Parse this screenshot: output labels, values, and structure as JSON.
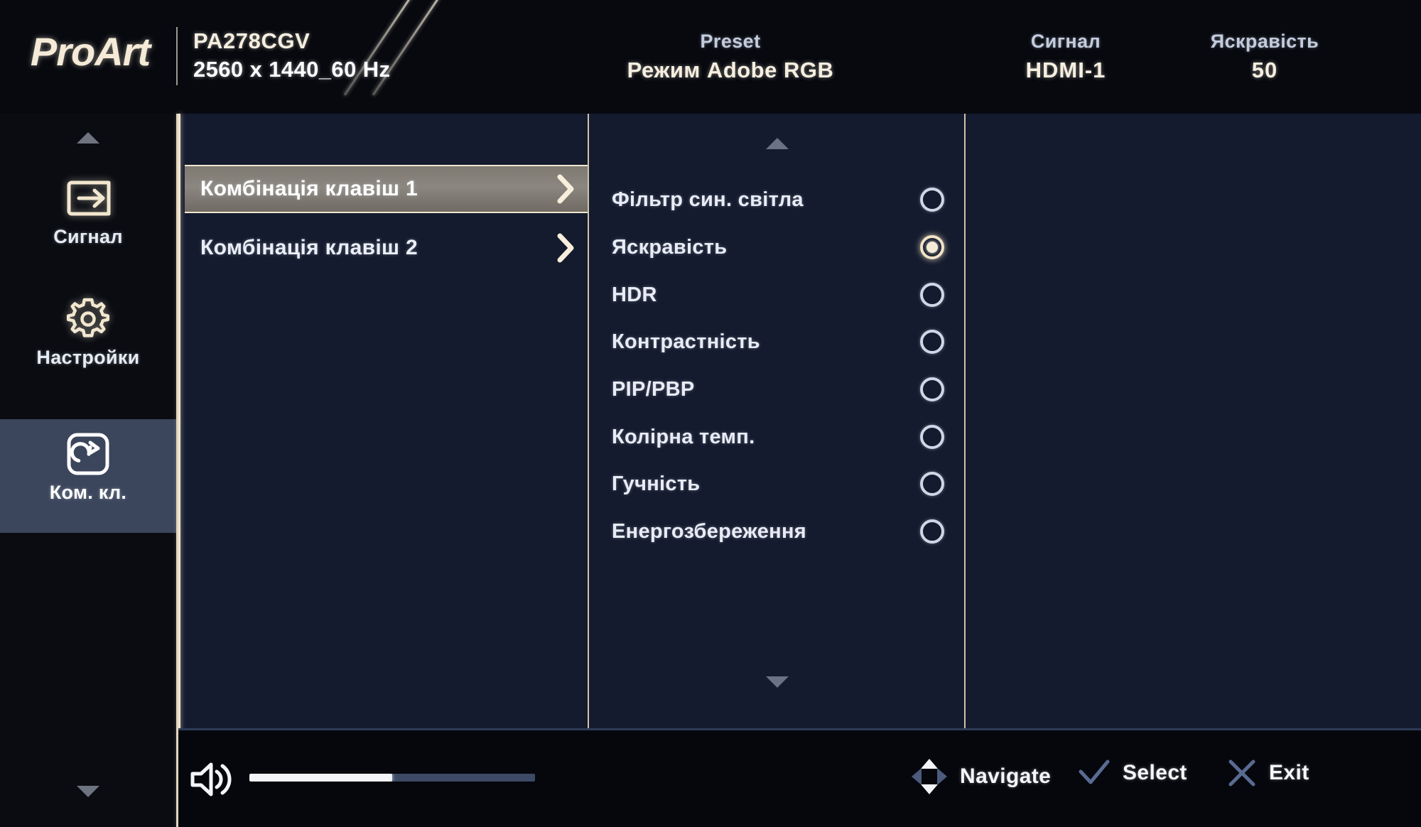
{
  "header": {
    "brand": "ProArt",
    "model_name": "PA278CGV",
    "model_resolution": "2560 x 1440_60 Hz",
    "stats": [
      {
        "label": "Preset",
        "value": "Режим Adobe RGB"
      },
      {
        "label": "Сигнал",
        "value": "HDMI-1"
      },
      {
        "label": "Яскравість",
        "value": "50"
      }
    ],
    "accent_color": "#f0e6cf"
  },
  "sidebar": {
    "scroll_up_icon": "triangle-up-icon",
    "scroll_down_icon": "triangle-down-icon",
    "items": [
      {
        "label": "Сигнал",
        "icon": "input-signal-icon",
        "selected": false
      },
      {
        "label": "Настройки",
        "icon": "gear-icon",
        "selected": false
      },
      {
        "label": "Ком. кл.",
        "icon": "shortcut-redo-icon",
        "selected": true
      }
    ],
    "selected_bg": "#3b465c"
  },
  "menu": {
    "items": [
      {
        "label": "Комбінація клавіш 1",
        "chevron": "chevron-right-icon",
        "active": true
      },
      {
        "label": "Комбінація клавіш 2",
        "chevron": "chevron-right-icon",
        "active": false
      }
    ]
  },
  "options": {
    "scroll_up_icon": "triangle-up-icon",
    "scroll_down_icon": "triangle-down-icon",
    "items": [
      {
        "label": "Фільтр син. світла",
        "selected": false
      },
      {
        "label": "Яскравість",
        "selected": true
      },
      {
        "label": "HDR",
        "selected": false
      },
      {
        "label": "Контрастність",
        "selected": false
      },
      {
        "label": "PIP/PBP",
        "selected": false
      },
      {
        "label": "Колірна темп.",
        "selected": false
      },
      {
        "label": "Гучність",
        "selected": false
      },
      {
        "label": "Енергозбереження",
        "selected": false
      }
    ],
    "selected_color": "#f1e4c6"
  },
  "footer": {
    "volume_icon": "speaker-volume-icon",
    "volume_percent": 50,
    "hints": [
      {
        "icon": "dpad-navigate-icon",
        "label": "Navigate"
      },
      {
        "icon": "check-icon",
        "label": "Select"
      },
      {
        "icon": "close-x-icon",
        "label": "Exit"
      }
    ]
  }
}
